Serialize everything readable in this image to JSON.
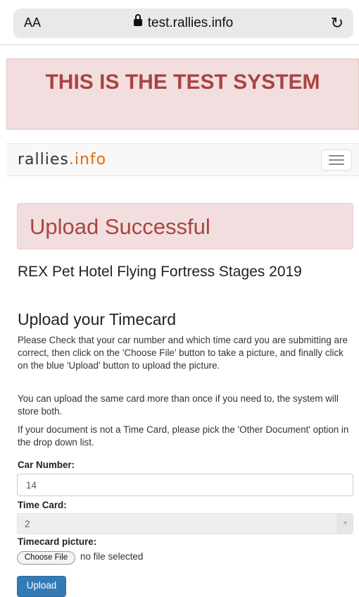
{
  "browser": {
    "text_size_label": "AA",
    "url": "test.rallies.info",
    "reload_glyph": "↻"
  },
  "banner": {
    "text": "THIS IS THE TEST SYSTEM"
  },
  "navbar": {
    "brand_prefix": "rallies",
    "brand_suffix": ".info"
  },
  "alert": {
    "text": "Upload Successful"
  },
  "event": {
    "title": "REX Pet Hotel Flying Fortress Stages 2019"
  },
  "form": {
    "heading": "Upload your Timecard",
    "instructions": [
      "Please Check that your car number and which time card you are submitting are correct, then click on the 'Choose File' button to take a picture, and finally click on the blue 'Upload' button to upload the picture.",
      "You can upload the same card more than once if you need to, the system will store both.",
      "If your document is not a Time Card, please pick the 'Other Document' option in the drop down list."
    ],
    "car_number_label": "Car Number:",
    "car_number_value": "14",
    "time_card_label": "Time Card:",
    "time_card_value": "2",
    "picture_label": "Timecard picture:",
    "choose_file_label": "Choose File",
    "file_status": "no file selected",
    "upload_label": "Upload"
  },
  "colors": {
    "danger_bg": "#f2dede",
    "danger_text": "#a94442",
    "primary": "#337ab7",
    "brand_accent": "#e36c0a"
  }
}
